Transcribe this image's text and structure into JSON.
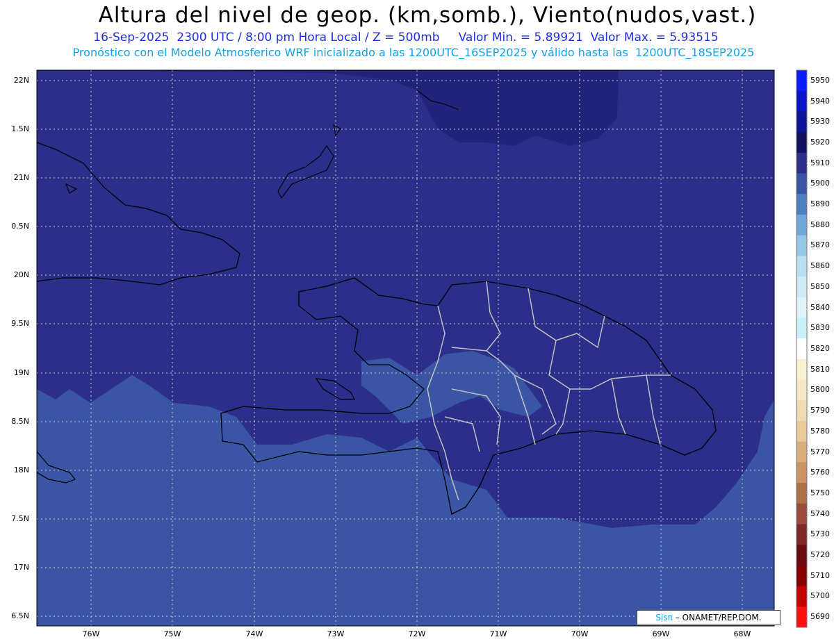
{
  "header": {
    "title": "Altura del nivel de geop. (km,somb.), Viento(nudos,vast.)",
    "subtitle_line1": "16-Sep-2025  2300 UTC / 8:00 pm Hora Local / Z = 500mb     Valor Min. = 5.89921  Valor Max. = 5.93515",
    "subtitle_line2": "Pronóstico con el Modelo Atmosferico WRF inicializado a las 1200UTC_16SEP2025 y válido hasta las  1200UTC_18SEP2025"
  },
  "map": {
    "lat_labels": [
      "22N",
      "1.5N",
      "21N",
      "0.5N",
      "20N",
      "9.5N",
      "19N",
      "8.5N",
      "18N",
      "7.5N",
      "17N",
      "6.5N"
    ],
    "lon_labels": [
      "76W",
      "75W",
      "74W",
      "73W",
      "72W",
      "71W",
      "70W",
      "69W",
      "68W"
    ],
    "colors": {
      "level_5920": "#22237a",
      "level_5910": "#2b2f8a",
      "level_5900": "#3a55a3"
    }
  },
  "credit": {
    "logo_text": "Sisπ",
    "text": "– ONAMET/REP.DOM."
  },
  "colorbar": {
    "levels": [
      "5950",
      "5940",
      "5930",
      "5920",
      "5910",
      "5900",
      "5890",
      "5880",
      "5870",
      "5860",
      "5850",
      "5840",
      "5830",
      "5820",
      "5810",
      "5800",
      "5790",
      "5780",
      "5770",
      "5760",
      "5750",
      "5740",
      "5730",
      "5720",
      "5710",
      "5700",
      "5690"
    ],
    "colors": [
      "#0a1cff",
      "#0a15c8",
      "#0b1596",
      "#12135e",
      "#2b2f8a",
      "#3a55a3",
      "#4f7fbf",
      "#6fa5d8",
      "#96c6e6",
      "#b8e0f2",
      "#cfeaf6",
      "#dff2f9",
      "#c8f0f8",
      "#ffffff",
      "#f9f0cf",
      "#f5e8c4",
      "#f0dcb4",
      "#e8c99a",
      "#d9ad7c",
      "#c99363",
      "#b0704a",
      "#9a4d3a",
      "#7e2a2a",
      "#6a0a12",
      "#8a0000",
      "#c40000",
      "#ff1010"
    ]
  }
}
